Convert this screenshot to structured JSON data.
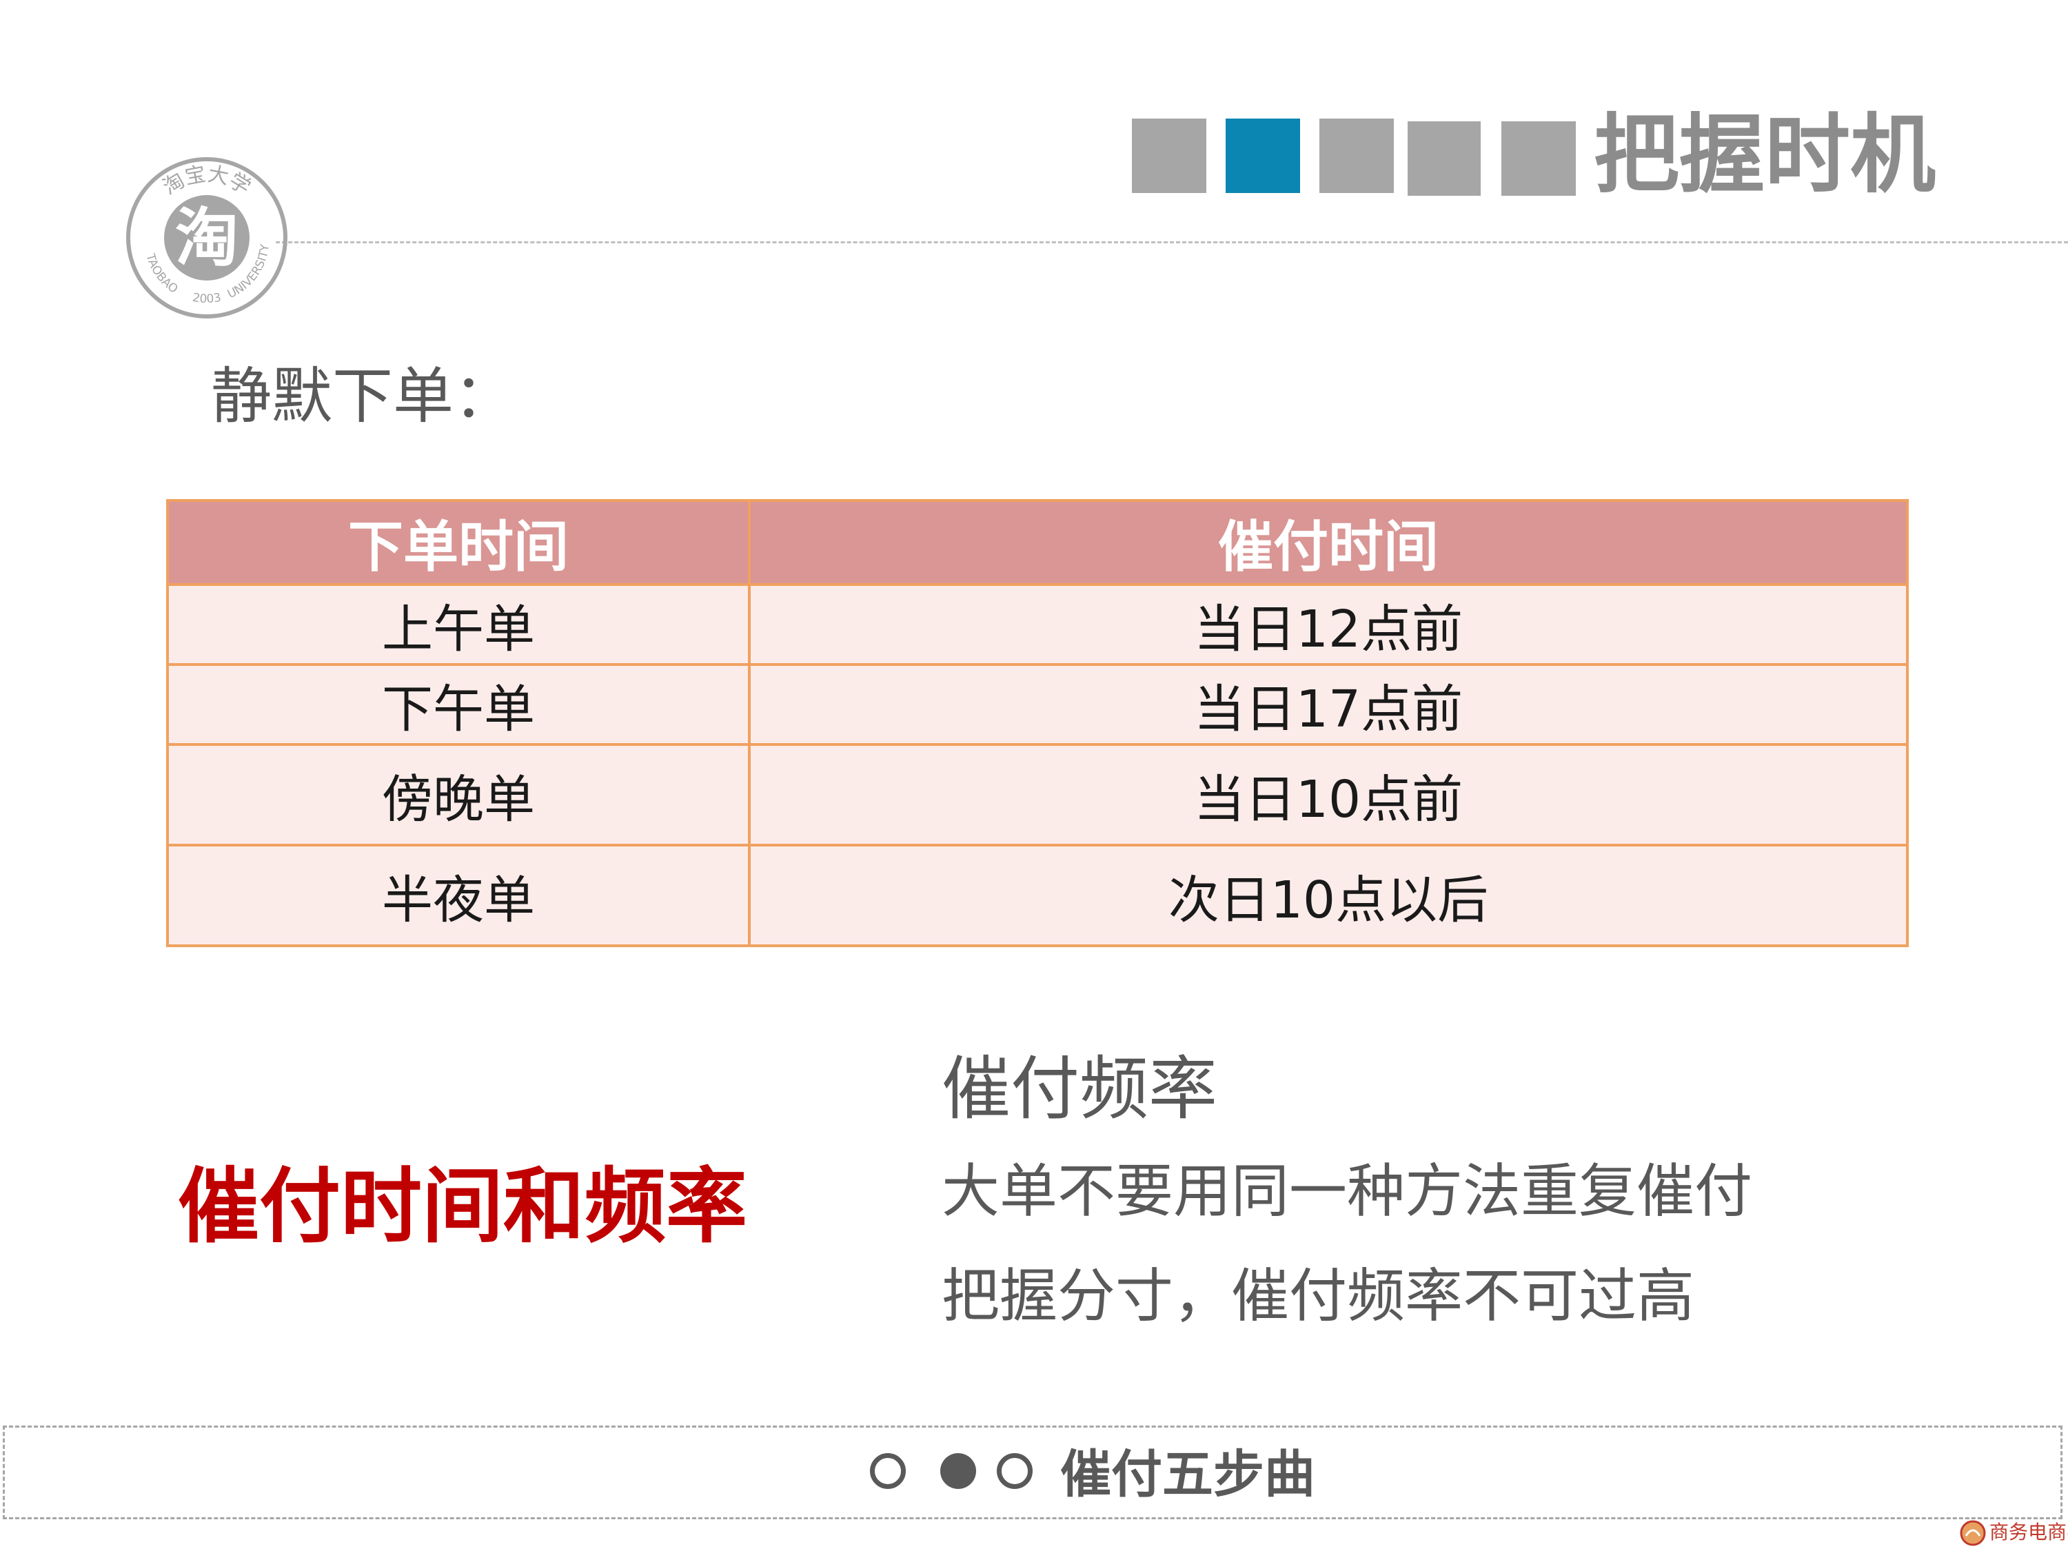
{
  "header": {
    "title": "把握时机",
    "steps": [
      {
        "active": false
      },
      {
        "active": true
      },
      {
        "active": false
      },
      {
        "active": false
      },
      {
        "active": false
      }
    ],
    "accent_color": "#0b85b1",
    "inactive_color": "#a6a6a6"
  },
  "logo": {
    "top_text": "淘宝大学",
    "center_char": "淘",
    "left_text": "TAOBAO",
    "right_text": "UNIVERSITY",
    "year": "2003"
  },
  "subtitle": "静默下单：",
  "table": {
    "headers": [
      "下单时间",
      "催付时间"
    ],
    "rows": [
      [
        "上午单",
        "当日12点前"
      ],
      [
        "下午单",
        "当日17点前"
      ],
      [
        "傍晚单",
        "当日10点前"
      ],
      [
        "半夜单",
        "次日10点以后"
      ]
    ],
    "header_bg": "#d99694",
    "row_bg": "#fbecea",
    "border_color": "#f0a15f"
  },
  "highlight": {
    "text": "催付时间和频率",
    "color": "#c00000"
  },
  "frequency": {
    "title": "催付频率",
    "lines": [
      "大单不要用同一种方法重复催付",
      "把握分寸，催付频率不可过高"
    ]
  },
  "footer": {
    "indicators": [
      "outline",
      "filled",
      "outline"
    ],
    "title": "催付五步曲"
  },
  "corner_logo": {
    "text": "商务电商学院"
  }
}
